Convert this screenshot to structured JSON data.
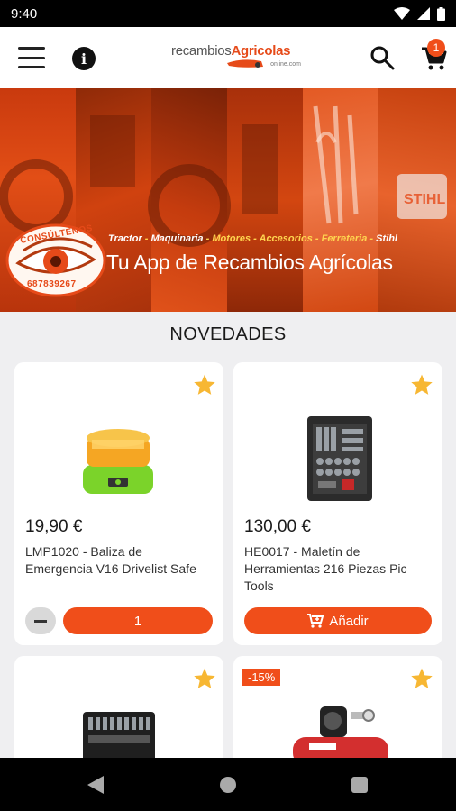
{
  "status": {
    "time": "9:40"
  },
  "header": {
    "menu_icon": "hamburger-icon",
    "info_icon": "info-icon",
    "logo_part1": "recambios",
    "logo_part2": "Agricolas",
    "logo_sub": "online.com",
    "search_icon": "search-icon",
    "cart_icon": "cart-icon",
    "cart_count": "1"
  },
  "banner": {
    "categories": [
      "Tractor",
      "Maquinaria",
      "Motores",
      "Accesorios",
      "Ferreteria",
      "Stihl"
    ],
    "slogan": "Tu App de Recambios Agrícolas",
    "consult": "CONSÚLTENOS",
    "phone": "687839267",
    "brand_mark": "STIHL"
  },
  "section": {
    "title": "NOVEDADES"
  },
  "products": [
    {
      "price": "19,90 €",
      "title": "LMP1020 - Baliza de Emergencia V16 Drivelist Safe",
      "quantity": "1"
    },
    {
      "price": "130,00 €",
      "title": "HE0017 - Maletín de Herramientas 216 Piezas Pic Tools",
      "add_label": "Añadir"
    },
    {
      "price": "",
      "title": ""
    },
    {
      "price": "",
      "title": "",
      "discount": "-15%"
    }
  ],
  "colors": {
    "accent": "#f04e1a",
    "star": "#f7b733",
    "background": "#efeff1"
  }
}
